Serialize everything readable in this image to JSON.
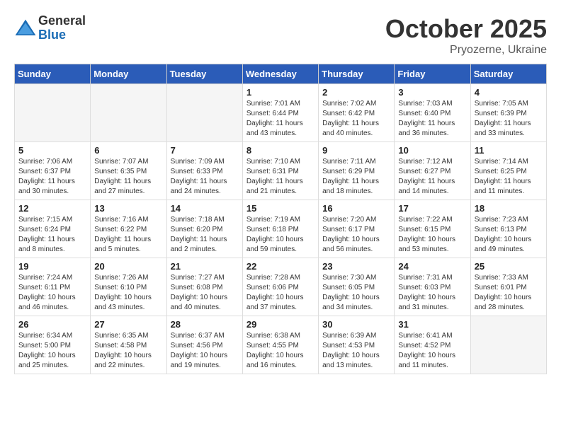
{
  "logo": {
    "general": "General",
    "blue": "Blue"
  },
  "title": "October 2025",
  "location": "Pryozerne, Ukraine",
  "days_of_week": [
    "Sunday",
    "Monday",
    "Tuesday",
    "Wednesday",
    "Thursday",
    "Friday",
    "Saturday"
  ],
  "weeks": [
    [
      {
        "day": "",
        "sunrise": "",
        "sunset": "",
        "daylight": "",
        "empty": true
      },
      {
        "day": "",
        "sunrise": "",
        "sunset": "",
        "daylight": "",
        "empty": true
      },
      {
        "day": "",
        "sunrise": "",
        "sunset": "",
        "daylight": "",
        "empty": true
      },
      {
        "day": "1",
        "sunrise": "Sunrise: 7:01 AM",
        "sunset": "Sunset: 6:44 PM",
        "daylight": "Daylight: 11 hours and 43 minutes."
      },
      {
        "day": "2",
        "sunrise": "Sunrise: 7:02 AM",
        "sunset": "Sunset: 6:42 PM",
        "daylight": "Daylight: 11 hours and 40 minutes."
      },
      {
        "day": "3",
        "sunrise": "Sunrise: 7:03 AM",
        "sunset": "Sunset: 6:40 PM",
        "daylight": "Daylight: 11 hours and 36 minutes."
      },
      {
        "day": "4",
        "sunrise": "Sunrise: 7:05 AM",
        "sunset": "Sunset: 6:39 PM",
        "daylight": "Daylight: 11 hours and 33 minutes."
      }
    ],
    [
      {
        "day": "5",
        "sunrise": "Sunrise: 7:06 AM",
        "sunset": "Sunset: 6:37 PM",
        "daylight": "Daylight: 11 hours and 30 minutes."
      },
      {
        "day": "6",
        "sunrise": "Sunrise: 7:07 AM",
        "sunset": "Sunset: 6:35 PM",
        "daylight": "Daylight: 11 hours and 27 minutes."
      },
      {
        "day": "7",
        "sunrise": "Sunrise: 7:09 AM",
        "sunset": "Sunset: 6:33 PM",
        "daylight": "Daylight: 11 hours and 24 minutes."
      },
      {
        "day": "8",
        "sunrise": "Sunrise: 7:10 AM",
        "sunset": "Sunset: 6:31 PM",
        "daylight": "Daylight: 11 hours and 21 minutes."
      },
      {
        "day": "9",
        "sunrise": "Sunrise: 7:11 AM",
        "sunset": "Sunset: 6:29 PM",
        "daylight": "Daylight: 11 hours and 18 minutes."
      },
      {
        "day": "10",
        "sunrise": "Sunrise: 7:12 AM",
        "sunset": "Sunset: 6:27 PM",
        "daylight": "Daylight: 11 hours and 14 minutes."
      },
      {
        "day": "11",
        "sunrise": "Sunrise: 7:14 AM",
        "sunset": "Sunset: 6:25 PM",
        "daylight": "Daylight: 11 hours and 11 minutes."
      }
    ],
    [
      {
        "day": "12",
        "sunrise": "Sunrise: 7:15 AM",
        "sunset": "Sunset: 6:24 PM",
        "daylight": "Daylight: 11 hours and 8 minutes."
      },
      {
        "day": "13",
        "sunrise": "Sunrise: 7:16 AM",
        "sunset": "Sunset: 6:22 PM",
        "daylight": "Daylight: 11 hours and 5 minutes."
      },
      {
        "day": "14",
        "sunrise": "Sunrise: 7:18 AM",
        "sunset": "Sunset: 6:20 PM",
        "daylight": "Daylight: 11 hours and 2 minutes."
      },
      {
        "day": "15",
        "sunrise": "Sunrise: 7:19 AM",
        "sunset": "Sunset: 6:18 PM",
        "daylight": "Daylight: 10 hours and 59 minutes."
      },
      {
        "day": "16",
        "sunrise": "Sunrise: 7:20 AM",
        "sunset": "Sunset: 6:17 PM",
        "daylight": "Daylight: 10 hours and 56 minutes."
      },
      {
        "day": "17",
        "sunrise": "Sunrise: 7:22 AM",
        "sunset": "Sunset: 6:15 PM",
        "daylight": "Daylight: 10 hours and 53 minutes."
      },
      {
        "day": "18",
        "sunrise": "Sunrise: 7:23 AM",
        "sunset": "Sunset: 6:13 PM",
        "daylight": "Daylight: 10 hours and 49 minutes."
      }
    ],
    [
      {
        "day": "19",
        "sunrise": "Sunrise: 7:24 AM",
        "sunset": "Sunset: 6:11 PM",
        "daylight": "Daylight: 10 hours and 46 minutes."
      },
      {
        "day": "20",
        "sunrise": "Sunrise: 7:26 AM",
        "sunset": "Sunset: 6:10 PM",
        "daylight": "Daylight: 10 hours and 43 minutes."
      },
      {
        "day": "21",
        "sunrise": "Sunrise: 7:27 AM",
        "sunset": "Sunset: 6:08 PM",
        "daylight": "Daylight: 10 hours and 40 minutes."
      },
      {
        "day": "22",
        "sunrise": "Sunrise: 7:28 AM",
        "sunset": "Sunset: 6:06 PM",
        "daylight": "Daylight: 10 hours and 37 minutes."
      },
      {
        "day": "23",
        "sunrise": "Sunrise: 7:30 AM",
        "sunset": "Sunset: 6:05 PM",
        "daylight": "Daylight: 10 hours and 34 minutes."
      },
      {
        "day": "24",
        "sunrise": "Sunrise: 7:31 AM",
        "sunset": "Sunset: 6:03 PM",
        "daylight": "Daylight: 10 hours and 31 minutes."
      },
      {
        "day": "25",
        "sunrise": "Sunrise: 7:33 AM",
        "sunset": "Sunset: 6:01 PM",
        "daylight": "Daylight: 10 hours and 28 minutes."
      }
    ],
    [
      {
        "day": "26",
        "sunrise": "Sunrise: 6:34 AM",
        "sunset": "Sunset: 5:00 PM",
        "daylight": "Daylight: 10 hours and 25 minutes."
      },
      {
        "day": "27",
        "sunrise": "Sunrise: 6:35 AM",
        "sunset": "Sunset: 4:58 PM",
        "daylight": "Daylight: 10 hours and 22 minutes."
      },
      {
        "day": "28",
        "sunrise": "Sunrise: 6:37 AM",
        "sunset": "Sunset: 4:56 PM",
        "daylight": "Daylight: 10 hours and 19 minutes."
      },
      {
        "day": "29",
        "sunrise": "Sunrise: 6:38 AM",
        "sunset": "Sunset: 4:55 PM",
        "daylight": "Daylight: 10 hours and 16 minutes."
      },
      {
        "day": "30",
        "sunrise": "Sunrise: 6:39 AM",
        "sunset": "Sunset: 4:53 PM",
        "daylight": "Daylight: 10 hours and 13 minutes."
      },
      {
        "day": "31",
        "sunrise": "Sunrise: 6:41 AM",
        "sunset": "Sunset: 4:52 PM",
        "daylight": "Daylight: 10 hours and 11 minutes."
      },
      {
        "day": "",
        "sunrise": "",
        "sunset": "",
        "daylight": "",
        "empty": true
      }
    ]
  ]
}
